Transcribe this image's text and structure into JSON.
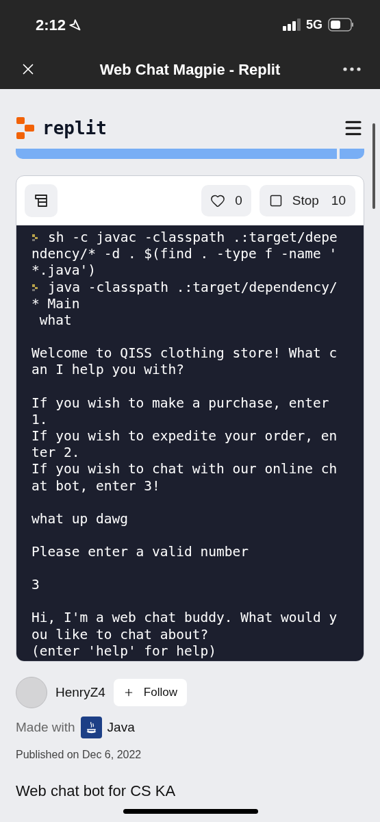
{
  "status_bar": {
    "time": "2:12",
    "network": "5G"
  },
  "browser": {
    "title": "Web Chat Magpie - Replit"
  },
  "header": {
    "logo_text": "replit"
  },
  "toolbar": {
    "likes": "0",
    "liked": false,
    "stop_label": "Stop",
    "stop_count": "10"
  },
  "console": {
    "blocks": [
      {
        "lines": [
          {
            "text": "sh -c javac -classpath .:target/depe",
            "prompt": true
          },
          {
            "text": "ndency/* -d . $(find . -type f -name '",
            "prompt": false
          },
          {
            "text": "*.java')",
            "prompt": false
          },
          {
            "text": "java -classpath .:target/dependency/",
            "prompt": true
          },
          {
            "text": "* Main",
            "prompt": false
          },
          {
            "text": " what",
            "prompt": false
          }
        ]
      },
      {
        "lines": [
          {
            "text": "Welcome to QISS clothing store! What c",
            "prompt": false
          },
          {
            "text": "an I help you with?",
            "prompt": false
          }
        ]
      },
      {
        "lines": [
          {
            "text": "If you wish to make a purchase, enter",
            "prompt": false
          },
          {
            "text": "1.",
            "prompt": false
          },
          {
            "text": "If you wish to expedite your order, en",
            "prompt": false
          },
          {
            "text": "ter 2.",
            "prompt": false
          },
          {
            "text": "If you wish to chat with our online ch",
            "prompt": false
          },
          {
            "text": "at bot, enter 3!",
            "prompt": false
          }
        ]
      },
      {
        "lines": [
          {
            "text": "what up dawg",
            "prompt": false
          }
        ]
      },
      {
        "lines": [
          {
            "text": "Please enter a valid number",
            "prompt": false
          }
        ]
      },
      {
        "lines": [
          {
            "text": "3",
            "prompt": false
          }
        ]
      },
      {
        "lines": [
          {
            "text": "Hi, I'm a web chat buddy. What would y",
            "prompt": false
          },
          {
            "text": "ou like to chat about?",
            "prompt": false
          },
          {
            "text": "(enter 'help' for help)",
            "prompt": false
          }
        ]
      }
    ]
  },
  "author": {
    "name": "HenryZ4",
    "follow_label": "Follow"
  },
  "made_with": {
    "label": "Made with",
    "language": "Java"
  },
  "published": "Published on Dec 6, 2022",
  "description": "Web chat bot for CS KA"
}
